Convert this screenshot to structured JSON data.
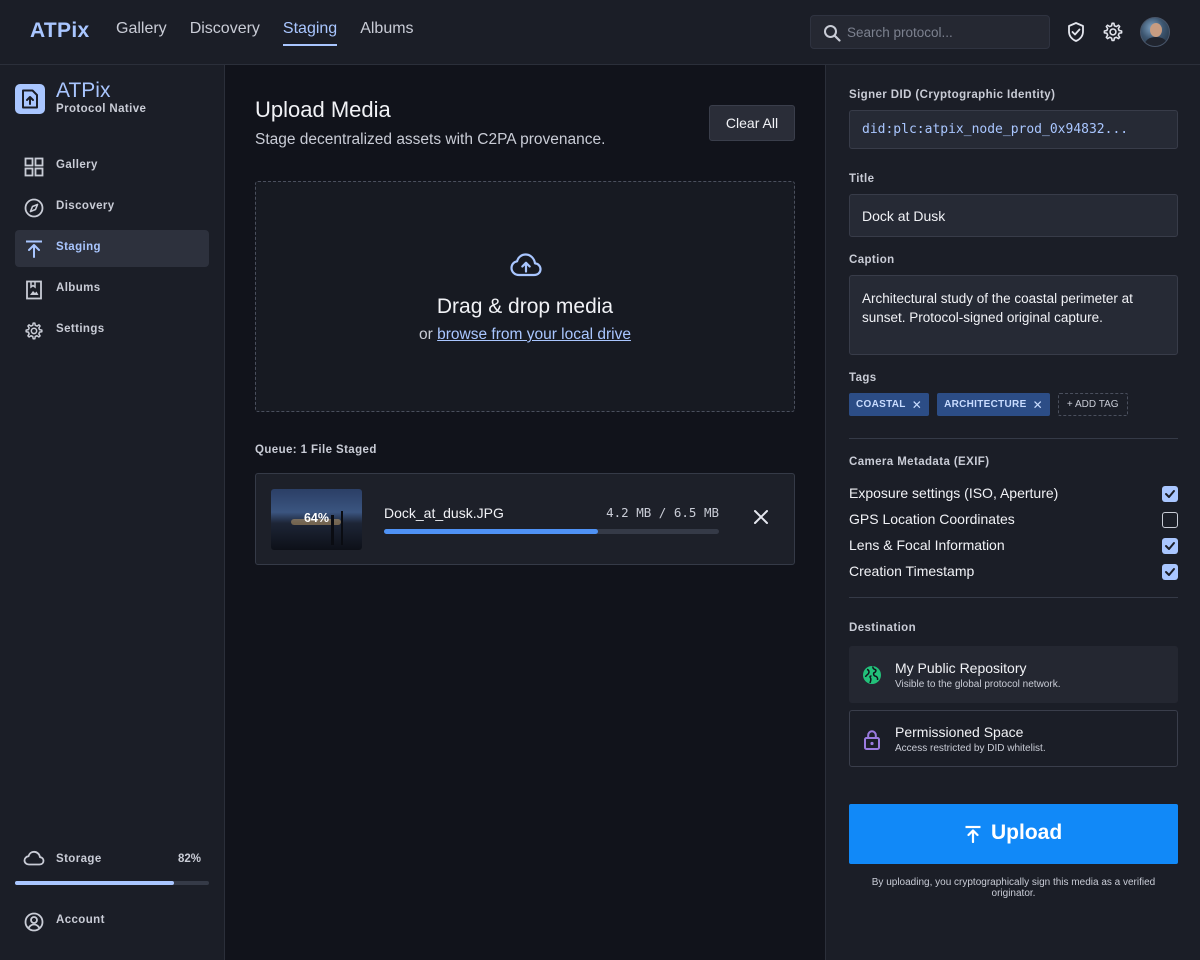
{
  "header": {
    "brand": "ATPix",
    "nav": [
      {
        "label": "Gallery"
      },
      {
        "label": "Discovery"
      },
      {
        "label": "Staging"
      },
      {
        "label": "Albums"
      }
    ],
    "search_placeholder": "Search protocol..."
  },
  "sidebar": {
    "title": "ATPix",
    "subtitle": "Protocol Native",
    "items": [
      {
        "label": "Gallery",
        "icon": "grid-icon"
      },
      {
        "label": "Discovery",
        "icon": "compass-icon"
      },
      {
        "label": "Staging",
        "icon": "upload-arrow-icon"
      },
      {
        "label": "Albums",
        "icon": "album-icon"
      },
      {
        "label": "Settings",
        "icon": "gear-icon"
      }
    ],
    "storage": {
      "label": "Storage",
      "percent_label": "82%",
      "fraction": 0.82
    },
    "account_label": "Account"
  },
  "main": {
    "title": "Upload Media",
    "subtitle": "Stage decentralized assets with C2PA provenance.",
    "clear_label": "Clear All",
    "dropzone": {
      "title": "Drag & drop media",
      "prefix": "or",
      "link": "browse from your local drive"
    },
    "queue_label": "Queue: 1 File Staged",
    "queue": [
      {
        "filename": "Dock_at_dusk.JPG",
        "size": "4.2 MB / 6.5 MB",
        "percent_label": "64%",
        "fraction": 0.64
      }
    ]
  },
  "metadata": {
    "did_label": "Signer DID (Cryptographic Identity)",
    "did_value": "did:plc:atpix_node_prod_0x94832...",
    "title_label": "Title",
    "title_value": "Dock at Dusk",
    "caption_label": "Caption",
    "caption_value": "Architectural study of the coastal perimeter at sunset. Protocol-signed original capture.",
    "tags_label": "Tags",
    "tags": [
      "COASTAL",
      "ARCHITECTURE"
    ],
    "add_tag_label": "+ ADD TAG",
    "exif_label": "Camera Metadata (EXIF)",
    "exif": [
      {
        "label": "Exposure settings (ISO, Aperture)",
        "checked": true
      },
      {
        "label": "GPS Location Coordinates",
        "checked": false
      },
      {
        "label": "Lens & Focal Information",
        "checked": true
      },
      {
        "label": "Creation Timestamp",
        "checked": true
      }
    ],
    "destination_label": "Destination",
    "destinations": [
      {
        "title": "My Public Repository",
        "subtitle": "Visible to the global protocol network.",
        "icon": "globe-icon",
        "selected": true
      },
      {
        "title": "Permissioned Space",
        "subtitle": "Access restricted by DID whitelist.",
        "icon": "lock-icon",
        "selected": false
      }
    ],
    "upload_label": "Upload",
    "upload_note": "By uploading, you cryptographically sign this media as a verified originator."
  },
  "colors": {
    "accent": "#a9c6ff",
    "primary_button": "#1189f8",
    "progress": "#4f92f5",
    "globe": "#22c17a",
    "lock": "#9b7be0"
  }
}
